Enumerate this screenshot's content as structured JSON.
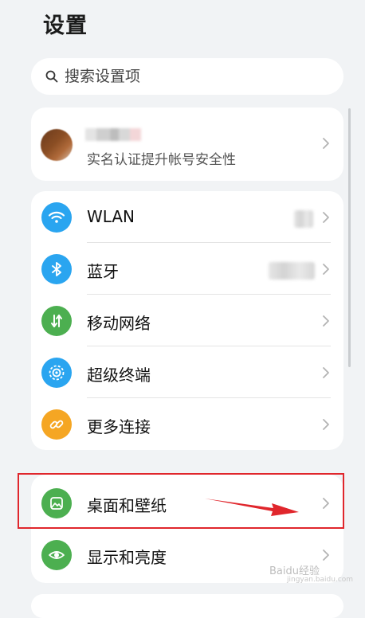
{
  "page": {
    "title": "设置"
  },
  "search": {
    "placeholder": "搜索设置项"
  },
  "account": {
    "subtitle": "实名认证提升帐号安全性"
  },
  "network": {
    "items": [
      {
        "label": "WLAN",
        "icon": "wifi-icon",
        "color": "#2aa5f0"
      },
      {
        "label": "蓝牙",
        "icon": "bluetooth-icon",
        "color": "#2aa5f0"
      },
      {
        "label": "移动网络",
        "icon": "mobile-network-icon",
        "color": "#4caf50"
      },
      {
        "label": "超级终端",
        "icon": "super-device-icon",
        "color": "#2aa5f0"
      },
      {
        "label": "更多连接",
        "icon": "link-icon",
        "color": "#f5a623"
      }
    ]
  },
  "display": {
    "items": [
      {
        "label": "桌面和壁纸",
        "icon": "wallpaper-icon",
        "color": "#4caf50"
      },
      {
        "label": "显示和亮度",
        "icon": "eye-icon",
        "color": "#4caf50"
      }
    ]
  },
  "annotation": {
    "highlight_color": "#e0262c"
  },
  "watermark": {
    "text": "Baidu经验",
    "sub": "jingyan.baidu.com"
  }
}
